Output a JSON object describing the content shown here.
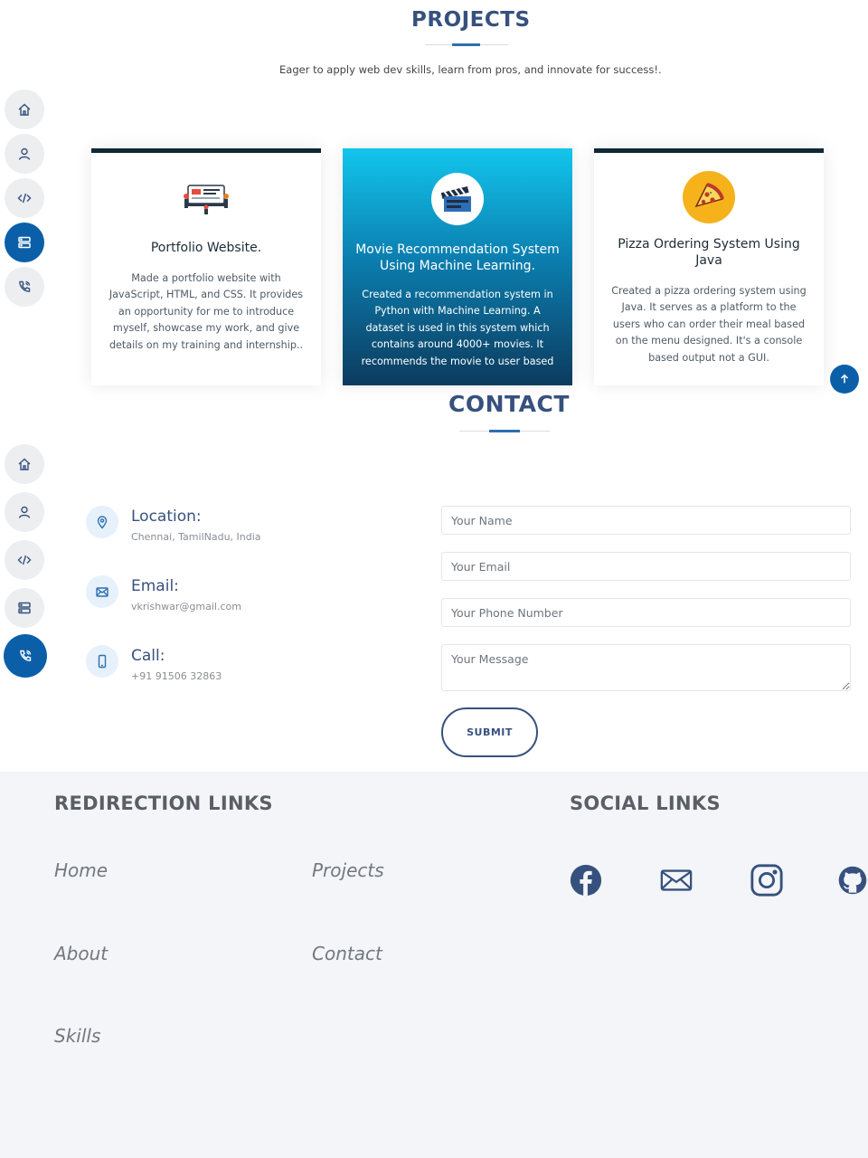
{
  "projects": {
    "title": "PROJECTS",
    "subtitle": "Eager to apply web dev skills, learn from pros, and innovate for success!.",
    "cards": [
      {
        "title": "Portfolio Website.",
        "description": "Made a portfolio website with JavaScript, HTML, and CSS. It provides an opportunity for me to introduce myself, showcase my work, and give details on my training and internship..",
        "icon": "portfolio-icon"
      },
      {
        "title": "Movie Recommendation System Using Machine Learning.",
        "description": "Created a recommendation system in Python with Machine Learning. A dataset is used in this system which contains around 4000+ movies. It recommends the movie to user based",
        "icon": "clapperboard-icon"
      },
      {
        "title": "Pizza Ordering System Using Java",
        "description": "Created a pizza ordering system using Java. It serves as a platform to the users who can order their meal based on the menu designed. It's a console based output not a GUI.",
        "icon": "pizza-icon"
      }
    ]
  },
  "contact": {
    "title": "CONTACT",
    "info": [
      {
        "label": "Location:",
        "value": "Chennai, TamilNadu, India",
        "icon": "location-pin-icon"
      },
      {
        "label": "Email:",
        "value": "vkrishwar@gmail.com",
        "icon": "envelope-icon"
      },
      {
        "label": "Call:",
        "value": "+91 91506 32863",
        "icon": "phone-icon"
      }
    ],
    "form": {
      "name_placeholder": "Your Name",
      "email_placeholder": "Your Email",
      "phone_placeholder": "Your Phone Number",
      "message_placeholder": "Your Message",
      "submit_label": "SUBMIT"
    }
  },
  "footer": {
    "redirection_title": "REDIRECTION LINKS",
    "social_title": "SOCIAL LINKS",
    "links": [
      "Home",
      "Projects",
      "About",
      "Contact",
      "Skills"
    ],
    "social": [
      "facebook-icon",
      "mail-icon",
      "instagram-icon",
      "github-icon"
    ]
  },
  "nav_icons": [
    "home-icon",
    "user-icon",
    "code-icon",
    "server-icon",
    "phone-icon"
  ],
  "colors": {
    "accent": "#0b5fa8",
    "heading": "#37517e",
    "featured_top": "#12c3ea",
    "featured_bottom": "#0c3b5e",
    "footer_bg": "#f3f5f8"
  }
}
